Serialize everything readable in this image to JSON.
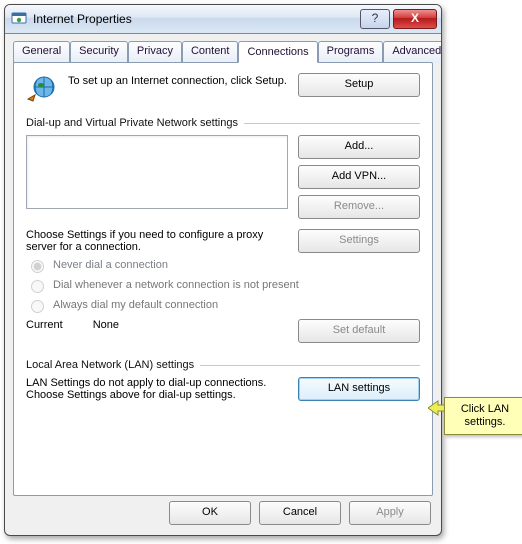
{
  "window": {
    "title": "Internet Properties"
  },
  "tabs": [
    "General",
    "Security",
    "Privacy",
    "Content",
    "Connections",
    "Programs",
    "Advanced"
  ],
  "active_tab": 4,
  "intro": {
    "text": "To set up an Internet connection, click Setup.",
    "setup_btn": "Setup"
  },
  "group_dial": {
    "label": "Dial-up and Virtual Private Network settings",
    "add_btn": "Add...",
    "addvpn_btn": "Add VPN...",
    "remove_btn": "Remove...",
    "settings_btn": "Settings",
    "desc": "Choose Settings if you need to configure a proxy server for a connection.",
    "r1": "Never dial a connection",
    "r2": "Dial whenever a network connection is not present",
    "r3": "Always dial my default connection",
    "current_label": "Current",
    "current_value": "None",
    "setdefault_btn": "Set default"
  },
  "group_lan": {
    "label": "Local Area Network (LAN) settings",
    "desc": "LAN Settings do not apply to dial-up connections. Choose Settings above for dial-up settings.",
    "btn": "LAN settings"
  },
  "footer": {
    "ok": "OK",
    "cancel": "Cancel",
    "apply": "Apply"
  },
  "callout": {
    "text": "Click LAN settings."
  }
}
